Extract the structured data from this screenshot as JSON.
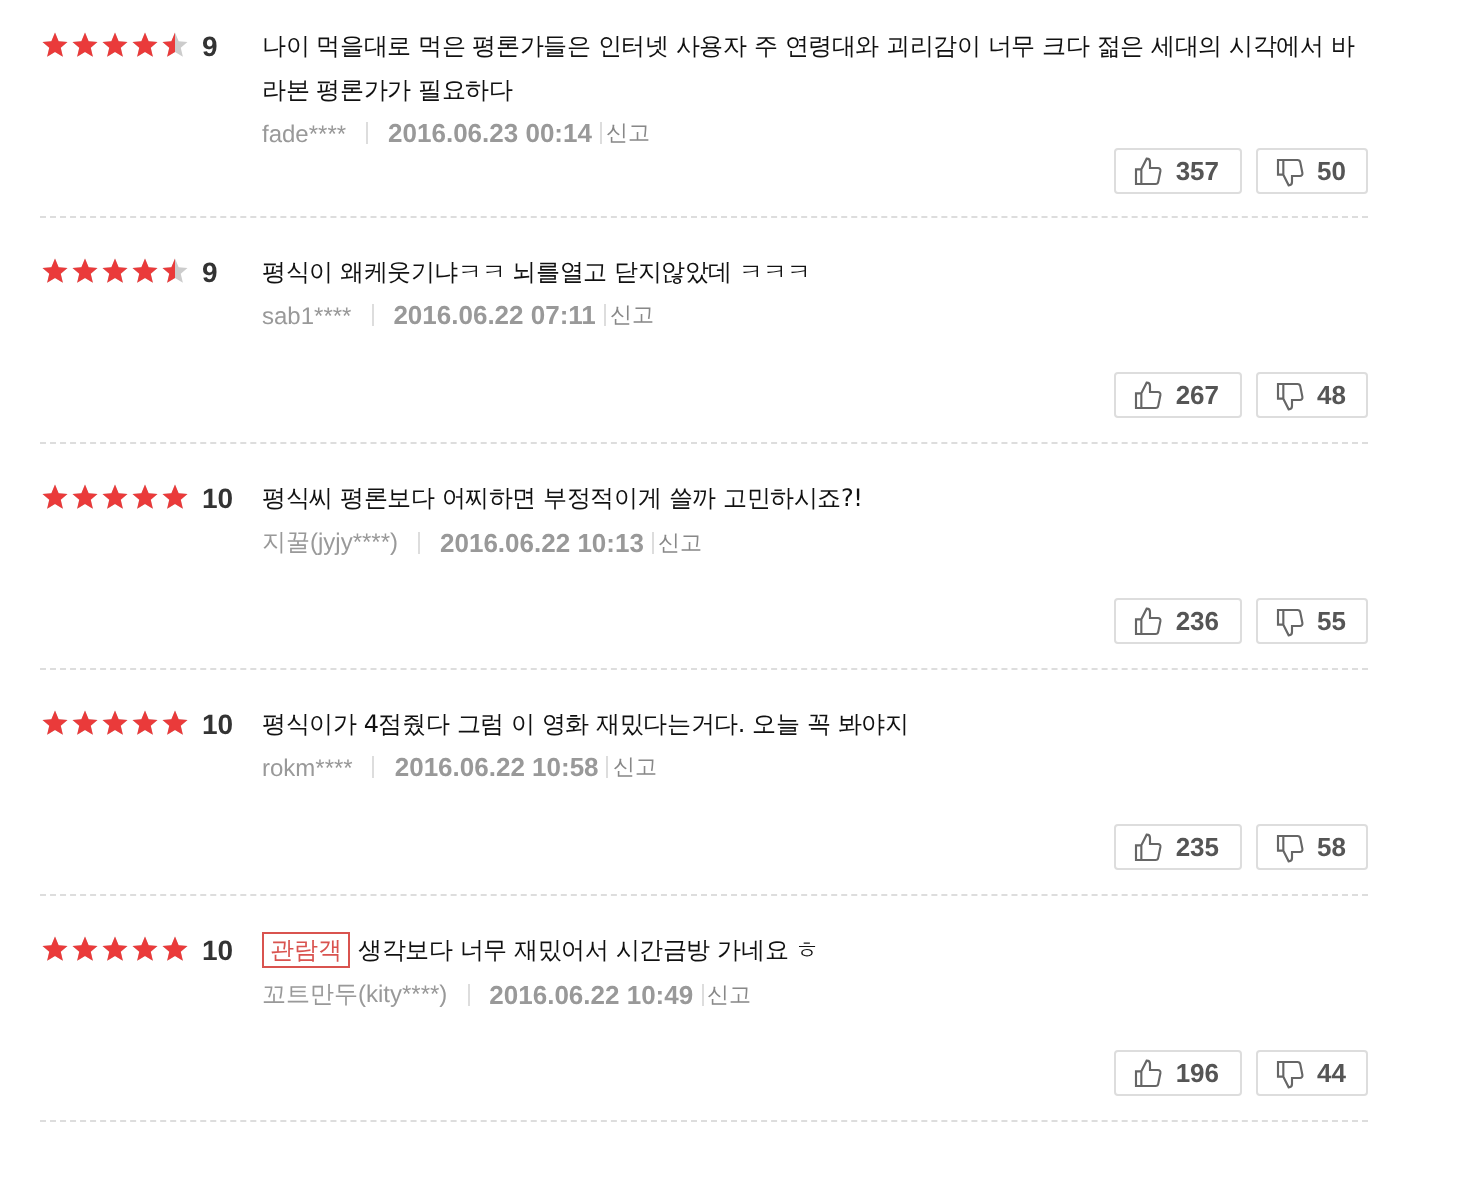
{
  "reviews": [
    {
      "stars": 4.5,
      "score": "9",
      "text": "나이 먹을대로 먹은 평론가들은 인터넷 사용자 주 연령대와 괴리감이 너무 크다 젊은 세대의 시각에서 바라본 평론가가 필요하다",
      "user": "fade****",
      "date": "2016.06.23 00:14",
      "report": "신고",
      "likes": "357",
      "dislikes": "50"
    },
    {
      "stars": 4.5,
      "score": "9",
      "text": "평식이 왜케웃기냐ㅋㅋ 뇌를열고 닫지않았데 ㅋㅋㅋ",
      "user": "sab1****",
      "date": "2016.06.22 07:11",
      "report": "신고",
      "likes": "267",
      "dislikes": "48"
    },
    {
      "stars": 5,
      "score": "10",
      "text": "평식씨 평론보다 어찌하면 부정적이게 쓸까 고민하시죠?!",
      "user": "지꿀(jyjy****)",
      "date": "2016.06.22 10:13",
      "report": "신고",
      "likes": "236",
      "dislikes": "55"
    },
    {
      "stars": 5,
      "score": "10",
      "text": "평식이가 4점줬다 그럼 이 영화 재밌다는거다. 오늘 꼭 봐야지",
      "user": "rokm****",
      "date": "2016.06.22 10:58",
      "report": "신고",
      "likes": "235",
      "dislikes": "58"
    },
    {
      "stars": 5,
      "score": "10",
      "badge": "관람객",
      "text": "생각보다 너무 재밌어서 시간금방 가네요 ㅎ",
      "user": "꼬트만두(kity****)",
      "date": "2016.06.22 10:49",
      "report": "신고",
      "likes": "196",
      "dislikes": "44"
    }
  ]
}
